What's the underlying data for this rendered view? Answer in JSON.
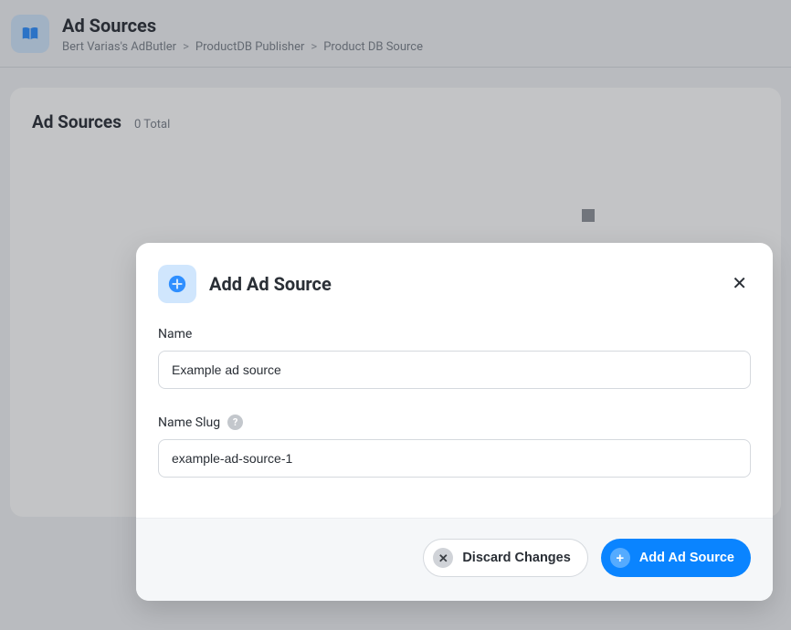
{
  "header": {
    "title": "Ad Sources",
    "breadcrumb": [
      "Bert Varias's AdButler",
      "ProductDB Publisher",
      "Product DB Source"
    ]
  },
  "panel": {
    "title": "Ad Sources",
    "subtitle": "0 Total"
  },
  "modal": {
    "title": "Add Ad Source",
    "fields": {
      "name": {
        "label": "Name",
        "value": "Example ad source"
      },
      "slug": {
        "label": "Name Slug",
        "value": "example-ad-source-1",
        "help": "?"
      }
    },
    "buttons": {
      "discard": "Discard Changes",
      "add": "Add Ad Source"
    }
  }
}
